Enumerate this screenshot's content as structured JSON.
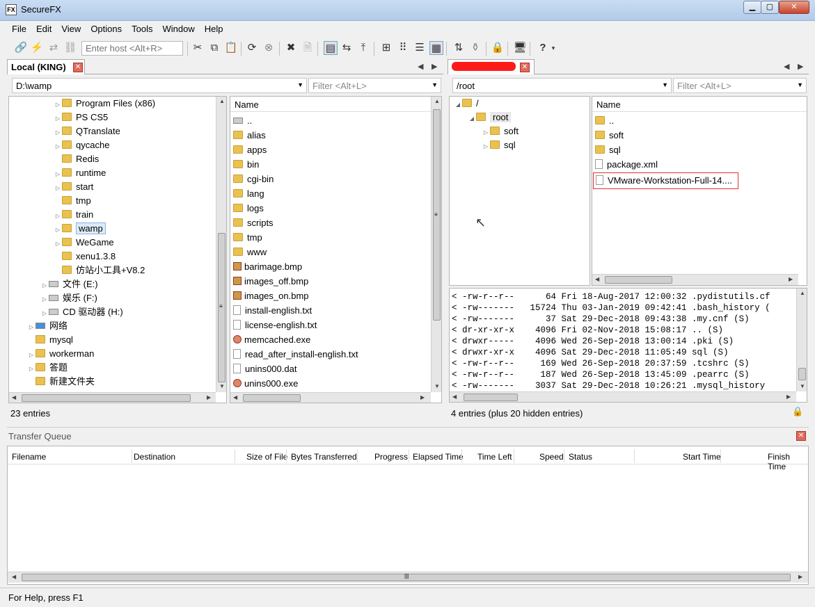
{
  "window": {
    "title": "SecureFX"
  },
  "menu": [
    "File",
    "Edit",
    "View",
    "Options",
    "Tools",
    "Window",
    "Help"
  ],
  "toolbar": {
    "host_placeholder": "Enter host <Alt+R>"
  },
  "local": {
    "tab_label": "Local (KING)",
    "path": "D:\\wamp",
    "filter_placeholder": "Filter <Alt+L>",
    "tree": [
      {
        "label": "Program Files (x86)",
        "icon": "folder",
        "expand": true
      },
      {
        "label": "PS CS5",
        "icon": "folder",
        "expand": true
      },
      {
        "label": "QTranslate",
        "icon": "folder",
        "expand": true
      },
      {
        "label": "qycache",
        "icon": "folder",
        "expand": true
      },
      {
        "label": "Redis",
        "icon": "folder",
        "expand": false
      },
      {
        "label": "runtime",
        "icon": "folder",
        "expand": true
      },
      {
        "label": "start",
        "icon": "folder",
        "expand": true
      },
      {
        "label": "tmp",
        "icon": "folder",
        "expand": false
      },
      {
        "label": "train",
        "icon": "folder",
        "expand": true
      },
      {
        "label": "wamp",
        "icon": "folder",
        "expand": true,
        "selected": true
      },
      {
        "label": "WeGame",
        "icon": "folder",
        "expand": true
      },
      {
        "label": "xenu1.3.8",
        "icon": "folder",
        "expand": false
      },
      {
        "label": "仿站小工具+V8.2",
        "icon": "folder",
        "expand": false
      },
      {
        "label": "文件 (E:)",
        "icon": "drive",
        "expand": true
      },
      {
        "label": "娱乐 (F:)",
        "icon": "drive",
        "expand": true
      },
      {
        "label": "CD 驱动器 (H:)",
        "icon": "drive",
        "expand": true
      },
      {
        "label": "网络",
        "icon": "network",
        "expand": true
      },
      {
        "label": "mysql",
        "icon": "folder",
        "expand": false
      },
      {
        "label": "workerman",
        "icon": "folder",
        "expand": true
      },
      {
        "label": "答题",
        "icon": "folder",
        "expand": true
      },
      {
        "label": "新建文件夹",
        "icon": "folder",
        "expand": false
      }
    ],
    "list_header": "Name",
    "files": [
      {
        "name": "..",
        "icon": "drive"
      },
      {
        "name": "alias",
        "icon": "folder"
      },
      {
        "name": "apps",
        "icon": "folder"
      },
      {
        "name": "bin",
        "icon": "folder"
      },
      {
        "name": "cgi-bin",
        "icon": "folder"
      },
      {
        "name": "lang",
        "icon": "folder"
      },
      {
        "name": "logs",
        "icon": "folder"
      },
      {
        "name": "scripts",
        "icon": "folder"
      },
      {
        "name": "tmp",
        "icon": "folder"
      },
      {
        "name": "www",
        "icon": "folder"
      },
      {
        "name": "barimage.bmp",
        "icon": "image"
      },
      {
        "name": "images_off.bmp",
        "icon": "image"
      },
      {
        "name": "images_on.bmp",
        "icon": "image"
      },
      {
        "name": "install-english.txt",
        "icon": "file"
      },
      {
        "name": "license-english.txt",
        "icon": "file"
      },
      {
        "name": "memcached.exe",
        "icon": "exe"
      },
      {
        "name": "read_after_install-english.txt",
        "icon": "file"
      },
      {
        "name": "unins000.dat",
        "icon": "file"
      },
      {
        "name": "unins000.exe",
        "icon": "exe"
      }
    ],
    "status": "23 entries"
  },
  "remote": {
    "path": "/root",
    "filter_placeholder": "Filter <Alt+L>",
    "tree": [
      {
        "label": "/",
        "level": 0,
        "expand": "open"
      },
      {
        "label": "root",
        "level": 1,
        "expand": "open",
        "selected": true
      },
      {
        "label": "soft",
        "level": 2,
        "expand": "closed"
      },
      {
        "label": "sql",
        "level": 2,
        "expand": "closed"
      }
    ],
    "list_header": "Name",
    "files": [
      {
        "name": "..",
        "icon": "folder"
      },
      {
        "name": "soft",
        "icon": "folder"
      },
      {
        "name": "sql",
        "icon": "folder"
      },
      {
        "name": "package.xml",
        "icon": "file"
      },
      {
        "name": "VMware-Workstation-Full-14....",
        "icon": "file",
        "highlighted": true
      }
    ],
    "log": [
      "< -rw-r--r--      64 Fri 18-Aug-2017 12:00:32 .pydistutils.cf",
      "< -rw-------   15724 Thu 03-Jan-2019 09:42:41 .bash_history (",
      "< -rw-------      37 Sat 29-Dec-2018 09:43:38 .my.cnf (S)",
      "< dr-xr-xr-x    4096 Fri 02-Nov-2018 15:08:17 .. (S)",
      "< drwxr-----    4096 Wed 26-Sep-2018 13:00:14 .pki (S)",
      "< drwxr-xr-x    4096 Sat 29-Dec-2018 11:05:49 sql (S)",
      "< -rw-r--r--     169 Wed 26-Sep-2018 20:37:59 .tcshrc (S)",
      "< -rw-r--r--     187 Wed 26-Sep-2018 13:45:09 .pearrc (S)",
      "< -rw-------    3037 Sat 29-Dec-2018 10:26:21 .mysql_history"
    ],
    "status": "4 entries (plus 20 hidden entries)"
  },
  "transfer": {
    "title": "Transfer Queue",
    "columns": [
      "Filename",
      "Destination",
      "Size of File",
      "Bytes Transferred",
      "Progress",
      "Elapsed Time",
      "Time Left",
      "Speed",
      "Status",
      "Start Time",
      "Finish Time"
    ]
  },
  "statusbar": {
    "text": "For Help, press F1"
  }
}
